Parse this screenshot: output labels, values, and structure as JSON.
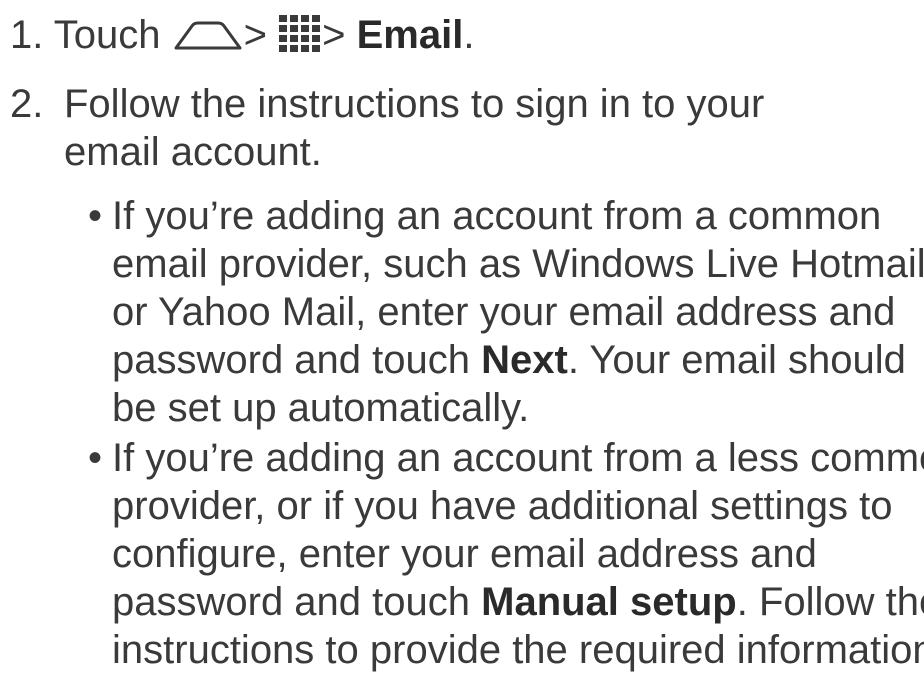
{
  "step1": {
    "number": "1.",
    "touch_label": "Touch",
    "separator": ">",
    "home_icon": "home-icon",
    "apps_icon": "apps-grid-icon",
    "email_label": "Email",
    "period": "."
  },
  "step2": {
    "number": "2.",
    "lines": [
      "Follow the instructions to sign in to your",
      "email account."
    ],
    "bullets": [
      {
        "lines": [
          "If you’re adding an account from a common",
          "email provider, such as Windows Live Hotmail",
          "or Yahoo Mail, enter your email address and"
        ],
        "line4_before": "password and touch ",
        "line4_bold": "Next",
        "line4_after": ". Your email should",
        "line5": "be set up automatically."
      },
      {
        "lines": [
          "If you’re adding an account from a less common",
          "provider, or if you have additional settings to",
          "configure, enter your email address and"
        ],
        "line4_before": "password and touch ",
        "line4_bold": "Manual setup",
        "line4_after": ". Follow the",
        "line5": "instructions to provide the required information."
      }
    ]
  },
  "colors": {
    "text": "#3a3a3a",
    "icon": "#3a3a3a"
  }
}
